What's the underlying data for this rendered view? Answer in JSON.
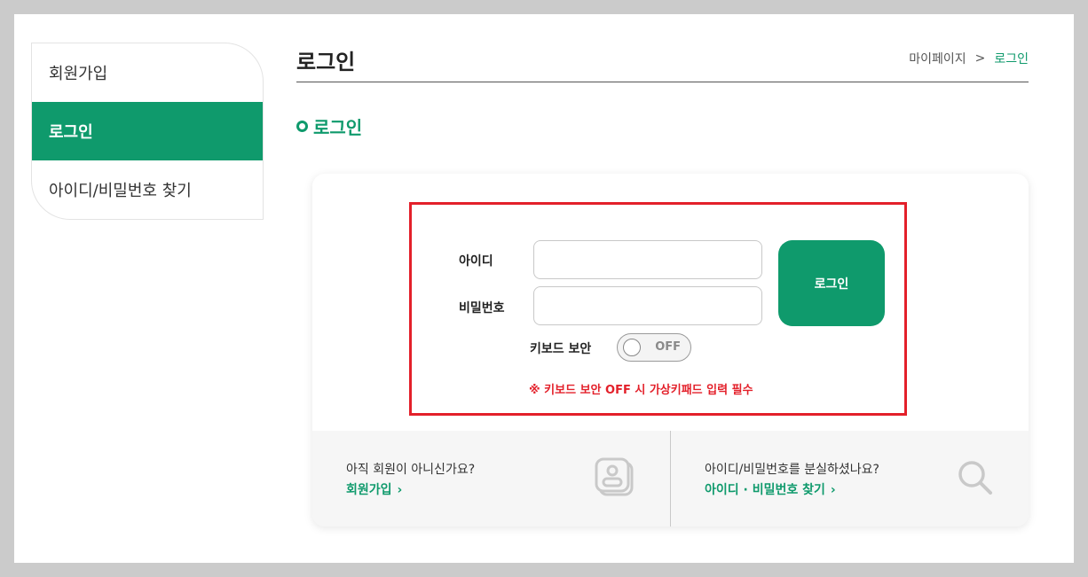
{
  "sidebar": {
    "items": [
      {
        "label": "회원가입",
        "active": false
      },
      {
        "label": "로그인",
        "active": true
      },
      {
        "label": "아이디/비밀번호 찾기",
        "active": false
      }
    ]
  },
  "header": {
    "title": "로그인",
    "breadcrumb": {
      "parent": "마이페이지",
      "separator": ">",
      "current": "로그인"
    }
  },
  "section": {
    "title": "로그인"
  },
  "form": {
    "id_label": "아이디",
    "id_value": "",
    "pw_label": "비밀번호",
    "pw_value": "",
    "login_button": "로그인",
    "keyboard_label": "키보드 보안",
    "keyboard_toggle": "OFF",
    "warning": "※ 키보드 보안 OFF 시 가상키패드 입력 필수"
  },
  "bottom": {
    "signup": {
      "question": "아직 회원이 아니신가요?",
      "link": "회원가입",
      "arrow": "›",
      "icon": "id-card-icon"
    },
    "find": {
      "question": "아이디/비밀번호를 분실하셨나요?",
      "link": "아이디 · 비밀번호 찾기",
      "arrow": "›",
      "icon": "search-icon"
    }
  },
  "colors": {
    "accent": "#0f9a6c",
    "highlight": "#e3202a",
    "warning": "#e3202a"
  }
}
